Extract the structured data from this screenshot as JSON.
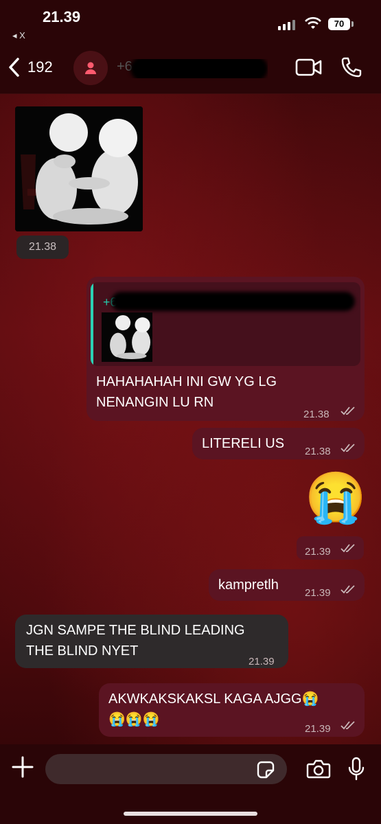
{
  "status": {
    "time": "21.39",
    "back_app": "◂ X",
    "battery": "70"
  },
  "header": {
    "back_count": "192",
    "contact_name": "+6"
  },
  "messages": [
    {
      "id": "m1",
      "type": "image",
      "time": "21.38"
    },
    {
      "id": "m2",
      "type": "reply",
      "quoted_name": "+6",
      "text_line1": "HAHAHAHAH INI GW YG LG",
      "text_line2": "NENANGIN LU RN",
      "time": "21.38"
    },
    {
      "id": "m3",
      "text": "LITERELI US",
      "time": "21.38"
    },
    {
      "id": "m4",
      "emoji": "😭",
      "time": "21.39"
    },
    {
      "id": "m5",
      "text": "kampretlh",
      "time": "21.39"
    },
    {
      "id": "m6",
      "text_line1": "JGN SAMPE THE BLIND LEADING",
      "text_line2": "THE BLIND NYET",
      "time": "21.39"
    },
    {
      "id": "m7",
      "text_line1": "AKWKAKSKAKSL KAGA AJGG😭",
      "text_line2": "😭😭😭",
      "time": "21.39"
    }
  ],
  "input": {
    "placeholder": ""
  },
  "colors": {
    "incoming": "#2e2a2b",
    "outgoing": "#5b1422",
    "accent": "#27c6a8"
  }
}
